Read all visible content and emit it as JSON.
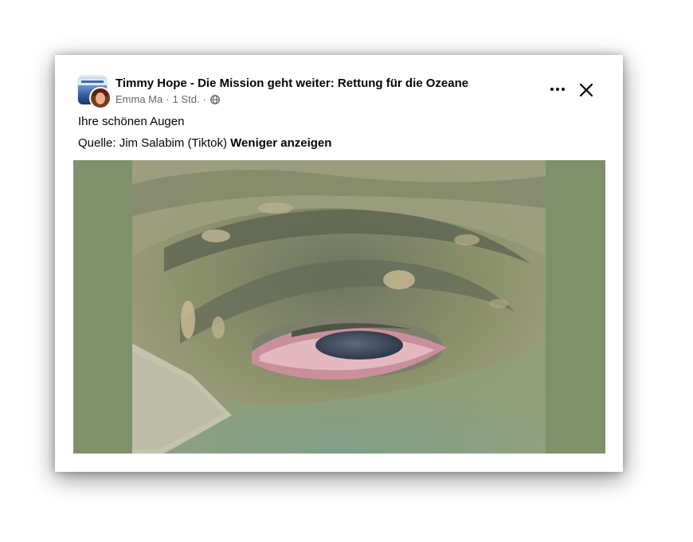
{
  "post": {
    "page_name": "Timmy Hope - Die Mission geht weiter: Rettung für die Ozeane",
    "author": "Emma Ma",
    "separator": "·",
    "time": "1 Std.",
    "audience_icon": "globe-icon",
    "text": "Ihre schönen Augen",
    "source_text": "Quelle: Jim Salabim (Tiktok)",
    "see_less_label": "Weniger anzeigen"
  },
  "actions": {
    "more_icon": "more-options-icon",
    "close_icon": "close-icon"
  },
  "media": {
    "letterbox_color": "#7f916a",
    "content": "underwater close-up of whale eye"
  }
}
